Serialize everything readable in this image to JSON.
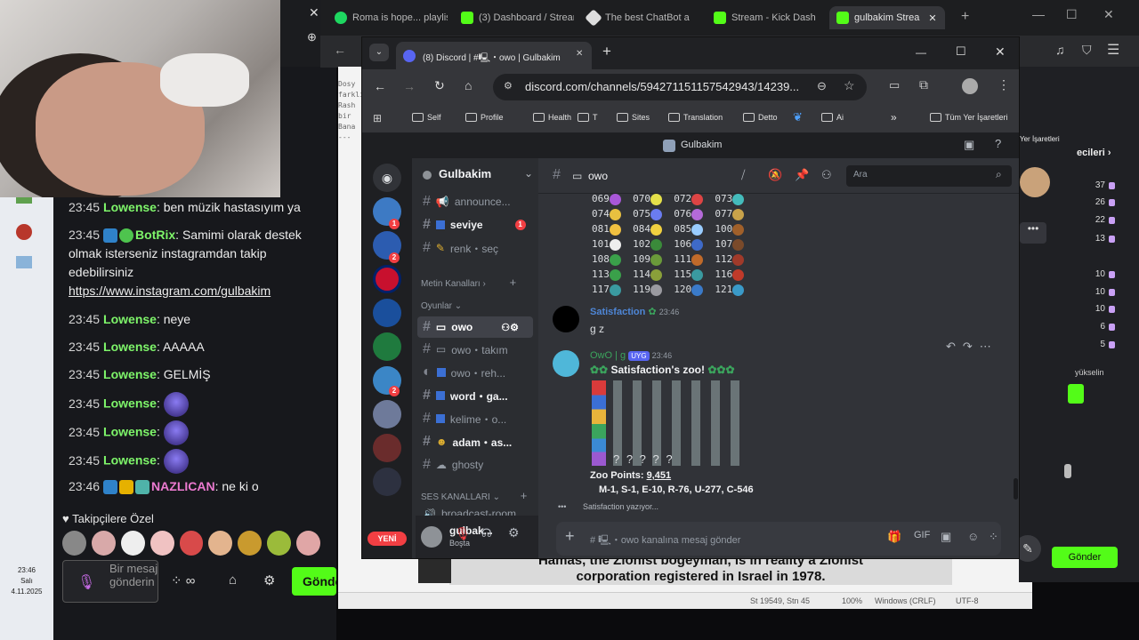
{
  "outer_browser": {
    "tabs": [
      {
        "label": "Roma is hope... playlist",
        "color": "#1ed760"
      },
      {
        "label": "(3) Dashboard / Streami",
        "color": "#53fc18"
      },
      {
        "label": "The best ChatBot a",
        "color": "#ffffff"
      },
      {
        "label": "Stream - Kick Dash",
        "color": "#53fc18"
      },
      {
        "label": "gulbakim Strea",
        "color": "#53fc18"
      }
    ]
  },
  "chat": {
    "messages": [
      {
        "time": "23:45",
        "user": "Lowense",
        "text": "ben müzik hastasıyım ya"
      },
      {
        "time": "23:45",
        "user": "BotRix",
        "text": "Samimi olarak destek olmak isterseniz instagramdan takip edebilirsiniz",
        "link": "https://www.instagram.com/gulbakim"
      },
      {
        "time": "23:45",
        "user": "Lowense",
        "text": "neye"
      },
      {
        "time": "23:45",
        "user": "Lowense",
        "text": "AAAAA"
      },
      {
        "time": "23:45",
        "user": "Lowense",
        "text": "GELMİŞ"
      },
      {
        "time": "23:45",
        "user": "Lowense",
        "text": ""
      },
      {
        "time": "23:45",
        "user": "Lowense",
        "text": ""
      },
      {
        "time": "23:45",
        "user": "Lowense",
        "text": ""
      },
      {
        "time": "23:46",
        "user": "NAZLICAN",
        "text": "ne ki o"
      }
    ],
    "followers_only": "Takipçilere Özel",
    "input_placeholder": "Bir mesaj gönderin",
    "send_label": "Gönder",
    "clock_time": "23:46",
    "clock_day": "Salı",
    "clock_date": "4.11.2025"
  },
  "discord_tab": {
    "title": "(8) Discord | #🖳・owo | Gulbakim"
  },
  "address_bar": {
    "url": "discord.com/channels/594271151157542943/14239..."
  },
  "bookmarks": [
    "Self",
    "Profile",
    "Health",
    "T",
    "Sites",
    "Translation",
    "Detto",
    "Ai",
    "Tüm Yer İşaretleri"
  ],
  "server_name": "Gulbakim",
  "channels": {
    "top": [
      {
        "name": "announce...",
        "bold": false
      },
      {
        "name": "seviye",
        "bold": true,
        "badge": "1"
      },
      {
        "name": "renk・seç",
        "bold": false
      }
    ],
    "category_text": "Metin Kanalları",
    "category_games": "Oyunlar",
    "games": [
      {
        "name": "owo",
        "bold": true
      },
      {
        "name": "owo・takım",
        "bold": false
      },
      {
        "name": "owo・reh...",
        "bold": false
      },
      {
        "name": "word・ga...",
        "bold": true
      },
      {
        "name": "kelime・o...",
        "bold": false
      },
      {
        "name": "adam・as...",
        "bold": true
      },
      {
        "name": "ghosty",
        "bold": false
      }
    ],
    "category_voice": "SES KANALLARI",
    "voice": "broadcast-room",
    "new_badge": "YENİ"
  },
  "user_panel": {
    "name": "gulbak...",
    "status": "Boşta"
  },
  "chat_header": {
    "channel": "owo",
    "search": "Ara"
  },
  "zoo_rows": [
    [
      "069",
      "070",
      "072",
      "073"
    ],
    [
      "074",
      "075",
      "076",
      "077"
    ],
    [
      "081",
      "084",
      "085",
      "100"
    ],
    [
      "101",
      "102",
      "106",
      "107"
    ],
    [
      "108",
      "109",
      "111",
      "112"
    ],
    [
      "113",
      "114",
      "115",
      "116"
    ],
    [
      "117",
      "119",
      "120",
      "121"
    ]
  ],
  "msg1": {
    "user": "Satisfaction",
    "time": "23:46",
    "text": "g z"
  },
  "msg2": {
    "user": "OwO | g",
    "tag": "UYG",
    "time": "23:46",
    "title": "Satisfaction's zoo!",
    "points_label": "Zoo Points:",
    "points_value": "9,451",
    "summary": "M-1, S-1, E-10, R-76, U-277, C-546"
  },
  "typing": "Satisfaction yazıyor...",
  "input_placeholder": "# 🖳・owo kanalına mesaj gönder",
  "right_panel": {
    "header": "Yer İşaretleri",
    "title": "ecileri",
    "counts": [
      "37",
      "26",
      "22",
      "13",
      "10",
      "10",
      "10",
      "6",
      "5"
    ],
    "note": "yükselin",
    "send_label": "Gönder"
  },
  "notepad": {
    "banner_line1": "Hamas, the Zionist bogeyman, is in reality a Zionist",
    "banner_line2": "corporation registered in Israel in 1978.",
    "status_pos": "St 19549, Stn 45",
    "status_zoom": "100%",
    "status_eol": "Windows (CRLF)",
    "status_enc": "UTF-8"
  }
}
